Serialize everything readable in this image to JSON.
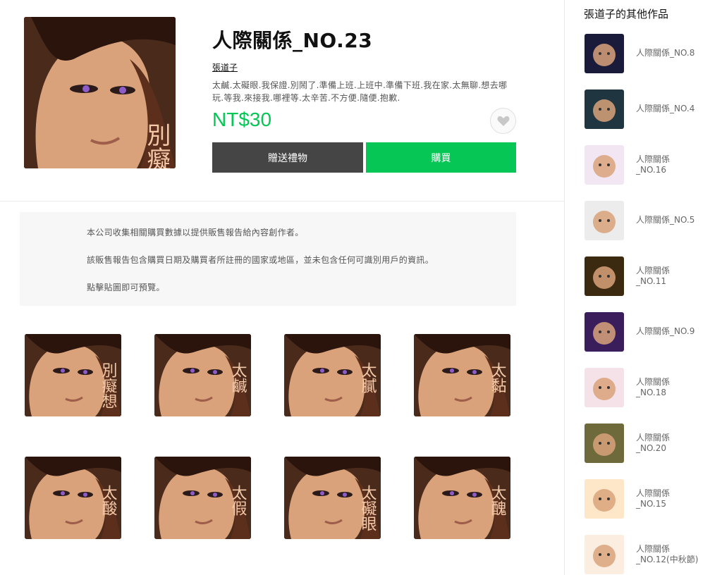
{
  "product": {
    "title": "人際關係_NO.23",
    "author": "張道子",
    "description": "太鹹.太礙眼.我保證.別鬧了.準備上班.上班中.準備下班.我在家.太無聊.想去哪玩.等我.來接我.哪裡等.太辛苦.不方便.隨便.抱歉.",
    "price": "NT$30",
    "gift_label": "贈送禮物",
    "buy_label": "購買",
    "cover_text": "別癡想"
  },
  "notice": {
    "line1": "本公司收集相關購買數據以提供販售報告給內容創作者。",
    "line2": "該販售報告包含購買日期及購買者所註冊的國家或地區，並未包含任何可識別用戶的資訊。",
    "line3": "點擊貼圖即可預覽。"
  },
  "stickers": [
    {
      "text": "別癡想"
    },
    {
      "text": "太鹹"
    },
    {
      "text": "太膩"
    },
    {
      "text": "太黏"
    },
    {
      "text": "太酸"
    },
    {
      "text": "太假"
    },
    {
      "text": "太礙眼"
    },
    {
      "text": "太醜"
    }
  ],
  "sidebar": {
    "title": "張道子的其他作品",
    "items": [
      {
        "line1": "人際關係_NO.8",
        "line2": "",
        "color": "#1a1a3a"
      },
      {
        "line1": "人際關係_NO.4",
        "line2": "",
        "color": "#1f3540"
      },
      {
        "line1": "人際關係",
        "line2": "_NO.16",
        "color": "#f3e6f3"
      },
      {
        "line1": "人際關係_NO.5",
        "line2": "",
        "color": "#ececec"
      },
      {
        "line1": "人際關係",
        "line2": "_NO.11",
        "color": "#3b2a10"
      },
      {
        "line1": "人際關係_NO.9",
        "line2": "",
        "color": "#3a1e5c"
      },
      {
        "line1": "人際關係",
        "line2": "_NO.18",
        "color": "#f5e1e8"
      },
      {
        "line1": "人際關係",
        "line2": "_NO.20",
        "color": "#6e6a3c"
      },
      {
        "line1": "人際關係",
        "line2": "_NO.15",
        "color": "#fde7c8"
      },
      {
        "line1": "人際關係",
        "line2": "_NO.12(中秋節)",
        "color": "#fbeee0"
      }
    ]
  }
}
